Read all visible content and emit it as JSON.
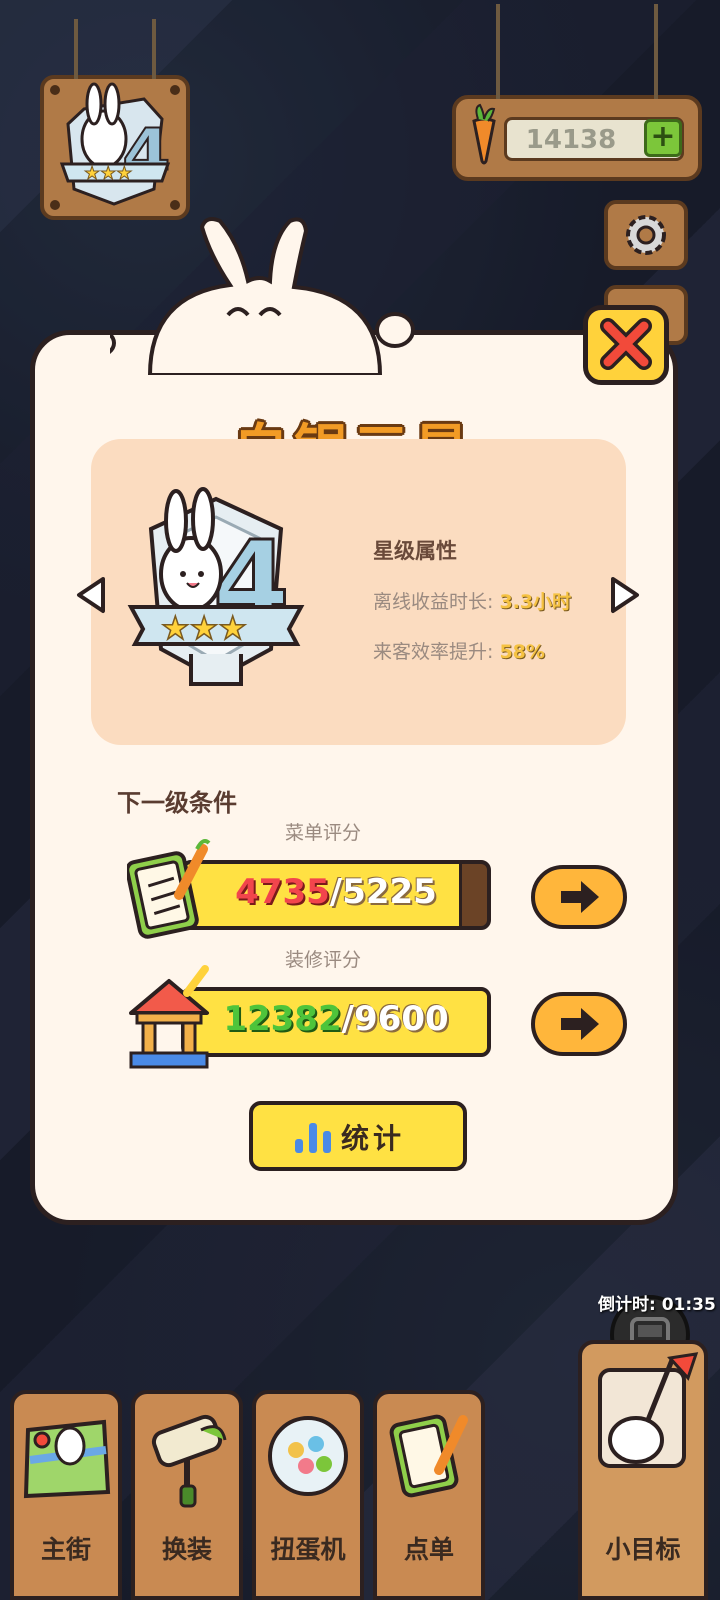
{
  "hud": {
    "carrots": "14138",
    "countdown": "倒计时: 01:35"
  },
  "dialog": {
    "title": "白银三星",
    "attributes_title": "星级属性",
    "offline_label": "离线收益时长: ",
    "offline_value": "3.3小时",
    "efficiency_label": "来客效率提升: ",
    "efficiency_value": "58%",
    "next_level_title": "下一级条件",
    "menu_score": {
      "label": "菜单评分",
      "current": "4735",
      "separator": "/",
      "target": "5225",
      "progress": 0.906
    },
    "decor_score": {
      "label": "装修评分",
      "current": "12382",
      "separator": "/",
      "target": "9600",
      "progress": 1.0
    },
    "stats_button": "统计"
  },
  "nav": {
    "items": [
      {
        "label": "主街",
        "icon": "map-icon"
      },
      {
        "label": "换装",
        "icon": "paint-roller-icon"
      },
      {
        "label": "扭蛋机",
        "icon": "gacha-machine-icon"
      },
      {
        "label": "点单",
        "icon": "menu-clipboard-icon"
      },
      {
        "label": "小目标",
        "icon": "goal-flag-icon"
      }
    ]
  },
  "colors": {
    "panel_bg": "#fff6ec",
    "card_bg": "#fbdcc0",
    "title": "#f29b25",
    "bar_fill": "#ffe143",
    "button_orange": "#ffb63b"
  }
}
